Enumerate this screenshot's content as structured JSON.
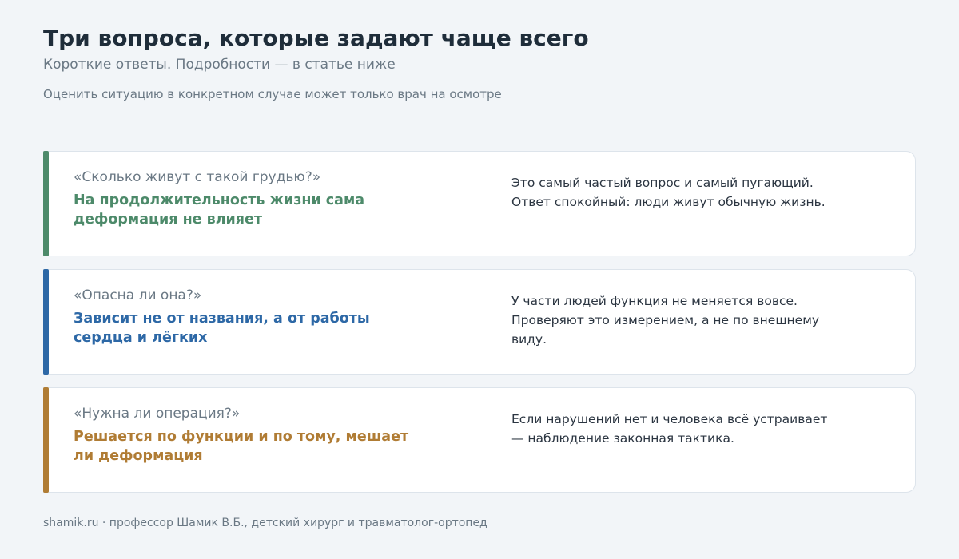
{
  "header": {
    "title": "Три вопроса, которые задают чаще всего",
    "subtitle": "Короткие ответы. Подробности — в статье ниже",
    "note": "Оценить ситуацию в конкретном случае может только врач на осмотре"
  },
  "cards": [
    {
      "question": "«Сколько живут с такой грудью?»",
      "answer": "На продолжительность жизни сама деформация не влияет",
      "explanation": "Это самый частый вопрос и самый пугающий. Ответ спокойный: люди живут обычную жизнь.",
      "accent_color": "#4d8a6a"
    },
    {
      "question": "«Опасна ли она?»",
      "answer": "Зависит не от названия, а от работы сердца и лёгких",
      "explanation": "У части людей функция не меняется вовсе. Проверяют это измерением, а не по внешнему виду.",
      "accent_color": "#2d68a6"
    },
    {
      "question": "«Нужна ли операция?»",
      "answer": "Решается по функции и по тому, мешает ли деформация",
      "explanation": "Если нарушений нет и человека всё устраивает — наблюдение законная тактика.",
      "accent_color": "#b07c34"
    }
  ],
  "footer": {
    "text": "shamik.ru · профессор Шамик В.Б., детский хирург и травматолог-ортопед"
  }
}
